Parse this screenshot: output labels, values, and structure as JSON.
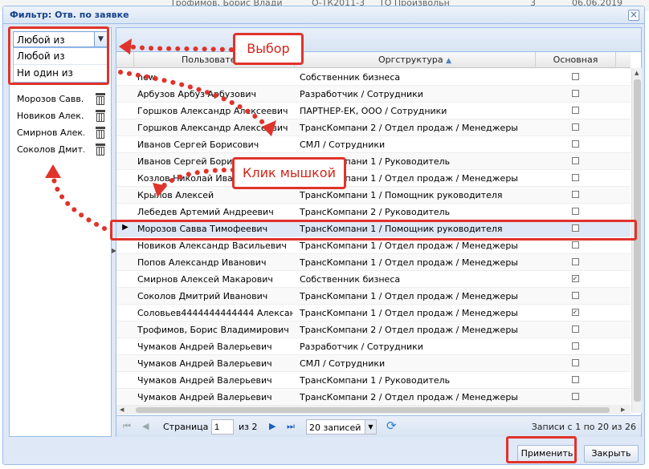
{
  "background_row": {
    "user": "Трофимов, Борис Влади",
    "code": "О-ТК2011-3",
    "type": "ТО Произвольн",
    "num": "3",
    "date": "06.06.2019"
  },
  "dialog": {
    "title": "Фильтр: Отв. по заявке",
    "close_icon": "close-icon"
  },
  "filter": {
    "combo_value": "Любой из",
    "options": [
      "Любой из",
      "Ни один из"
    ],
    "selected_items": [
      {
        "label": "Морозов Савв..."
      },
      {
        "label": "Новиков Алек..."
      },
      {
        "label": "Смирнов Алек..."
      },
      {
        "label": "Соколов Дмит..."
      }
    ]
  },
  "grid": {
    "columns": {
      "user": "Пользователь",
      "org": "Оргструктура",
      "main": "Основная"
    },
    "rows": [
      {
        "user": "new",
        "org": "Собственник бизнеса",
        "main": false
      },
      {
        "user": "Арбузов Арбуз Арбузович",
        "org": "Разработчик / Сотрудники",
        "main": false
      },
      {
        "user": "Горшков Александр Алексеевич",
        "org": "ПАРТНЕР-ЕК, ООО / Сотрудники",
        "main": false
      },
      {
        "user": "Горшков Александр Алексеевич",
        "org": "ТрансКомпани 2 / Отдел продаж / Менеджеры",
        "main": false
      },
      {
        "user": "Иванов Сергей Борисович",
        "org": "СМЛ / Сотрудники",
        "main": false
      },
      {
        "user": "Иванов Сергей Борисович",
        "org": "ТрансКомпани 1 / Руководитель",
        "main": false
      },
      {
        "user": "Козлов Николай Иванович",
        "org": "ТрансКомпани 1 / Отдел продаж / Менеджеры",
        "main": false
      },
      {
        "user": "Крылов Алексей",
        "org": "ТрансКомпани 1 / Помощник руководителя",
        "main": false
      },
      {
        "user": "Лебедев Артемий Андреевич",
        "org": "ТрансКомпани 2 / Руководитель",
        "main": false
      },
      {
        "user": "Морозов Савва Тимофеевич",
        "org": "ТрансКомпани 1 / Помощник руководителя",
        "main": false,
        "selected": true
      },
      {
        "user": "Новиков Александр Васильевич",
        "org": "ТрансКомпани 1 / Отдел продаж / Менеджеры",
        "main": false
      },
      {
        "user": "Попов Александр Иванович",
        "org": "ТрансКомпани 1 / Отдел продаж / Менеджеры",
        "main": false
      },
      {
        "user": "Смирнов Алексей Макарович",
        "org": "Собственник бизнеса",
        "main": true
      },
      {
        "user": "Соколов Дмитрий Иванович",
        "org": "ТрансКомпани 1 / Отдел продаж / Менеджеры",
        "main": false
      },
      {
        "user": "Соловьев4444444444444 Алексан...",
        "org": "ТрансКомпани 1 / Отдел продаж / Менеджеры",
        "main": true
      },
      {
        "user": "Трофимов, Борис Владимирович",
        "org": "ТрансКомпани 2 / Отдел продаж / Менеджеры",
        "main": false
      },
      {
        "user": "Чумаков Андрей Валерьевич",
        "org": "Разработчик / Сотрудники",
        "main": false
      },
      {
        "user": "Чумаков Андрей Валерьевич",
        "org": "СМЛ / Сотрудники",
        "main": false
      },
      {
        "user": "Чумаков Андрей Валерьевич",
        "org": "ТрансКомпани 1 / Руководитель",
        "main": false
      },
      {
        "user": "Чумаков Андрей Валерьевич",
        "org": "ТрансКомпани 2 / Отдел продаж / Менеджеры",
        "main": false
      }
    ]
  },
  "pager": {
    "page_label": "Страница",
    "page_value": "1",
    "of_label": "из 2",
    "page_size": "20 записей",
    "info": "Записи с 1 по 20 из 26"
  },
  "buttons": {
    "apply": "Применить",
    "close": "Закрыть"
  },
  "annotations": {
    "choice": "Выбор",
    "click": "Клик мышкой"
  },
  "colors": {
    "annotation": "#e0332b",
    "title": "#15428b",
    "selection": "#dfe8f6"
  }
}
